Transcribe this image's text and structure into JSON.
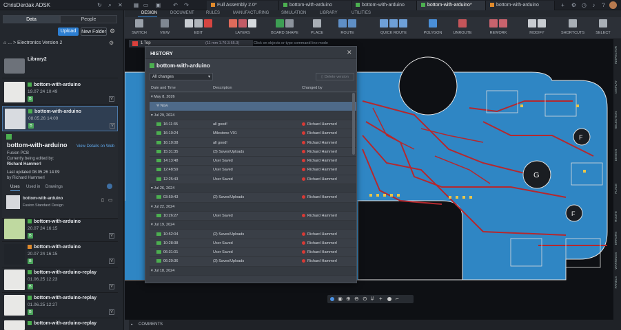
{
  "titlebar": {
    "user": "ChrisDerdak ADSK",
    "tabs": [
      {
        "label": "Full Assembly 2.0*",
        "color": "#e08a2c"
      },
      {
        "label": "bottom-with-arduino",
        "color": "#4caf50"
      },
      {
        "label": "bottom-with-arduino",
        "color": "#4caf50"
      },
      {
        "label": "bottom-with-arduino*",
        "color": "#4caf50"
      },
      {
        "label": "bottom-with-arduino",
        "color": "#e08a2c"
      }
    ]
  },
  "left": {
    "seg_data": "Data",
    "seg_people": "People",
    "upload": "Upload",
    "new_folder": "New Folder",
    "breadcrumb": "... > Electronics Version 2",
    "folder_name": "Library2",
    "files": [
      {
        "name": "bottom-with-arduino",
        "date": "19.07 24 10:49",
        "badge": "B",
        "version": "V"
      },
      {
        "name": "bottom-with-arduino",
        "date": "08.05.26 14:09",
        "badge": "B",
        "version": "V"
      }
    ],
    "detail": {
      "title": "bottom-with-arduino",
      "type": "Fusion PCB",
      "editing_label": "Currently being edited by:",
      "editing_user": "Richard Hammerl",
      "view_link": "View Details on Web",
      "updated_label": "Last updated 08.05.26 14:09",
      "updated_by": "by Richard Hammerl",
      "tab_uses": "Uses",
      "tab_used_in": "Used in",
      "tab_drawings": "Drawings",
      "use_name": "bottom-with-arduino",
      "use_sub": "Fusion Standard Design"
    },
    "files2": [
      {
        "name": "bottom-with-arduino",
        "date": "20.07 24 16:15",
        "badge": "B",
        "version": "V"
      },
      {
        "name": "bottom-with-arduino",
        "date": "20.07 24 16:15",
        "badge": "B",
        "version": "V"
      },
      {
        "name": "bottom-with-arduino-replay",
        "date": "01.06.25 12:23",
        "badge": "B",
        "version": "V"
      },
      {
        "name": "bottom-with-arduino-replay",
        "date": "01.06.25 12:27",
        "badge": "B",
        "version": "V"
      },
      {
        "name": "bottom-with-arduino-replay",
        "date": "",
        "badge": "",
        "version": ""
      }
    ]
  },
  "ribbon": {
    "tabs": [
      "DESIGN",
      "DOCUMENT",
      "RULES",
      "MANUFACTURING",
      "SIMULATION",
      "LIBRARY",
      "UTILITIES"
    ],
    "groups": [
      "SWITCH",
      "VIEW",
      "EDIT",
      "LAYERS",
      "BOARD SHAPE",
      "PLACE",
      "ROUTE",
      "QUICK ROUTE",
      "POLYGON",
      "UNROUTE",
      "REWORK",
      "MODIFY",
      "SHORTCUTS",
      "SELECT"
    ]
  },
  "canvas": {
    "layer": "1 Top",
    "coords": "(11 mm 1.76.3.65.3)",
    "hint": "Click on objects or type command line mode",
    "right_tabs": [
      "INSPECTOR",
      "DISPLAY",
      "SELECTION",
      "DESIGN",
      "PLACE",
      "ROUTE",
      "ERRORS",
      "WARNINGS",
      "PANELS"
    ]
  },
  "history": {
    "title": "HISTORY",
    "doc": "bottom-with-arduino",
    "filter": "All changes",
    "delete_btn": "Delete version",
    "cols": [
      "Date and Time",
      "Description",
      "Changed by"
    ],
    "rows": [
      {
        "kind": "group",
        "date": "May 8, 2026"
      },
      {
        "kind": "now",
        "date": "Now"
      },
      {
        "kind": "group",
        "date": "Jul 29, 2024"
      },
      {
        "kind": "item",
        "date": "16:11:35",
        "desc": "all good!",
        "by": "Richard Hammerl"
      },
      {
        "kind": "item",
        "date": "16:10:24",
        "desc": "Milestone V01",
        "by": "Richard Hammerl"
      },
      {
        "kind": "item",
        "date": "16:10:08",
        "desc": "all good!",
        "by": "Richard Hammerl"
      },
      {
        "kind": "item",
        "date": "15:31:35",
        "desc": "(3) Saves/Uploads",
        "by": "Richard Hammerl"
      },
      {
        "kind": "item",
        "date": "14:13:48",
        "desc": "User Saved",
        "by": "Richard Hammerl"
      },
      {
        "kind": "item",
        "date": "12:48:59",
        "desc": "User Saved",
        "by": "Richard Hammerl"
      },
      {
        "kind": "item",
        "date": "12:25:43",
        "desc": "User Saved",
        "by": "Richard Hammerl"
      },
      {
        "kind": "group",
        "date": "Jul 26, 2024"
      },
      {
        "kind": "item",
        "date": "03:50:43",
        "desc": "(2) Saves/Uploads",
        "by": "Richard Hammerl"
      },
      {
        "kind": "group",
        "date": "Jul 22, 2024"
      },
      {
        "kind": "item",
        "date": "10:26:27",
        "desc": "User Saved",
        "by": "Richard Hammerl"
      },
      {
        "kind": "group",
        "date": "Jul 19, 2024"
      },
      {
        "kind": "item",
        "date": "10:52:04",
        "desc": "(2) Saves/Uploads",
        "by": "Richard Hammerl"
      },
      {
        "kind": "item",
        "date": "10:28:38",
        "desc": "User Saved",
        "by": "Richard Hammerl"
      },
      {
        "kind": "item",
        "date": "06:31:01",
        "desc": "User Saved",
        "by": "Richard Hammerl"
      },
      {
        "kind": "item",
        "date": "06:29:36",
        "desc": "(3) Saves/Uploads",
        "by": "Richard Hammerl"
      },
      {
        "kind": "group",
        "date": "Jul 18, 2024"
      }
    ]
  },
  "comments": "COMMENTS"
}
